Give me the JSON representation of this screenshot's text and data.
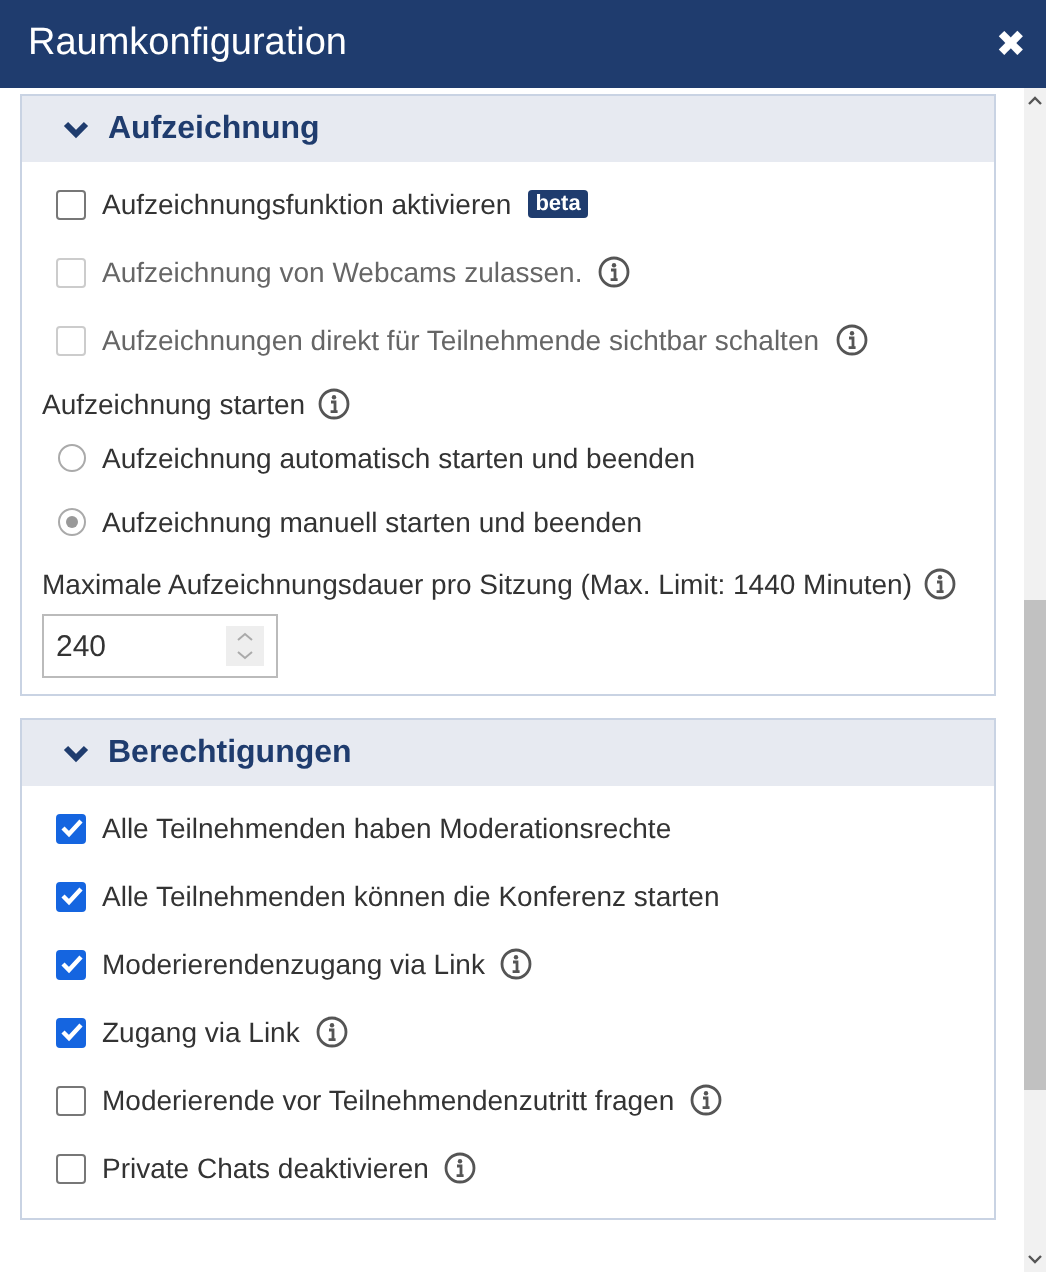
{
  "window": {
    "title": "Raumkonfiguration",
    "close": "✖"
  },
  "sections": [
    {
      "title": "Aufzeichnung",
      "expanded": true,
      "items": [
        {
          "kind": "checkbox",
          "label": "Aufzeichnungsfunktion aktivieren",
          "checked": false,
          "disabled": false,
          "info": false,
          "badge": "beta"
        },
        {
          "kind": "checkbox",
          "label": "Aufzeichnung von Webcams zulassen.",
          "checked": false,
          "disabled": true,
          "info": true
        },
        {
          "kind": "checkbox",
          "label": "Aufzeichnungen direkt für Teilnehmende sichtbar schalten",
          "checked": false,
          "disabled": true,
          "info": true
        },
        {
          "kind": "label",
          "label": "Aufzeichnung starten",
          "info": true
        },
        {
          "kind": "radio",
          "label": "Aufzeichnung automatisch starten und beenden",
          "selected": false,
          "disabled": true
        },
        {
          "kind": "radio",
          "label": "Aufzeichnung manuell starten und beenden",
          "selected": true,
          "disabled": true
        },
        {
          "kind": "label",
          "label": "Maximale Aufzeichnungsdauer pro Sitzung (Max. Limit: 1440 Minuten)",
          "info": true
        },
        {
          "kind": "number",
          "value": "240"
        }
      ]
    },
    {
      "title": "Berechtigungen",
      "expanded": true,
      "items": [
        {
          "kind": "checkbox",
          "label": "Alle Teilnehmenden haben Moderationsrechte",
          "checked": true,
          "disabled": false,
          "info": false
        },
        {
          "kind": "checkbox",
          "label": "Alle Teilnehmenden können die Konferenz starten",
          "checked": true,
          "disabled": false,
          "info": false
        },
        {
          "kind": "checkbox",
          "label": "Moderierendenzugang via Link",
          "checked": true,
          "disabled": false,
          "info": true
        },
        {
          "kind": "checkbox",
          "label": "Zugang via Link",
          "checked": true,
          "disabled": false,
          "info": true
        },
        {
          "kind": "checkbox",
          "label": "Moderierende vor Teilnehmendenzutritt fragen",
          "checked": false,
          "disabled": false,
          "info": true
        },
        {
          "kind": "checkbox",
          "label": "Private Chats deaktivieren",
          "checked": false,
          "disabled": false,
          "info": true
        }
      ]
    }
  ]
}
